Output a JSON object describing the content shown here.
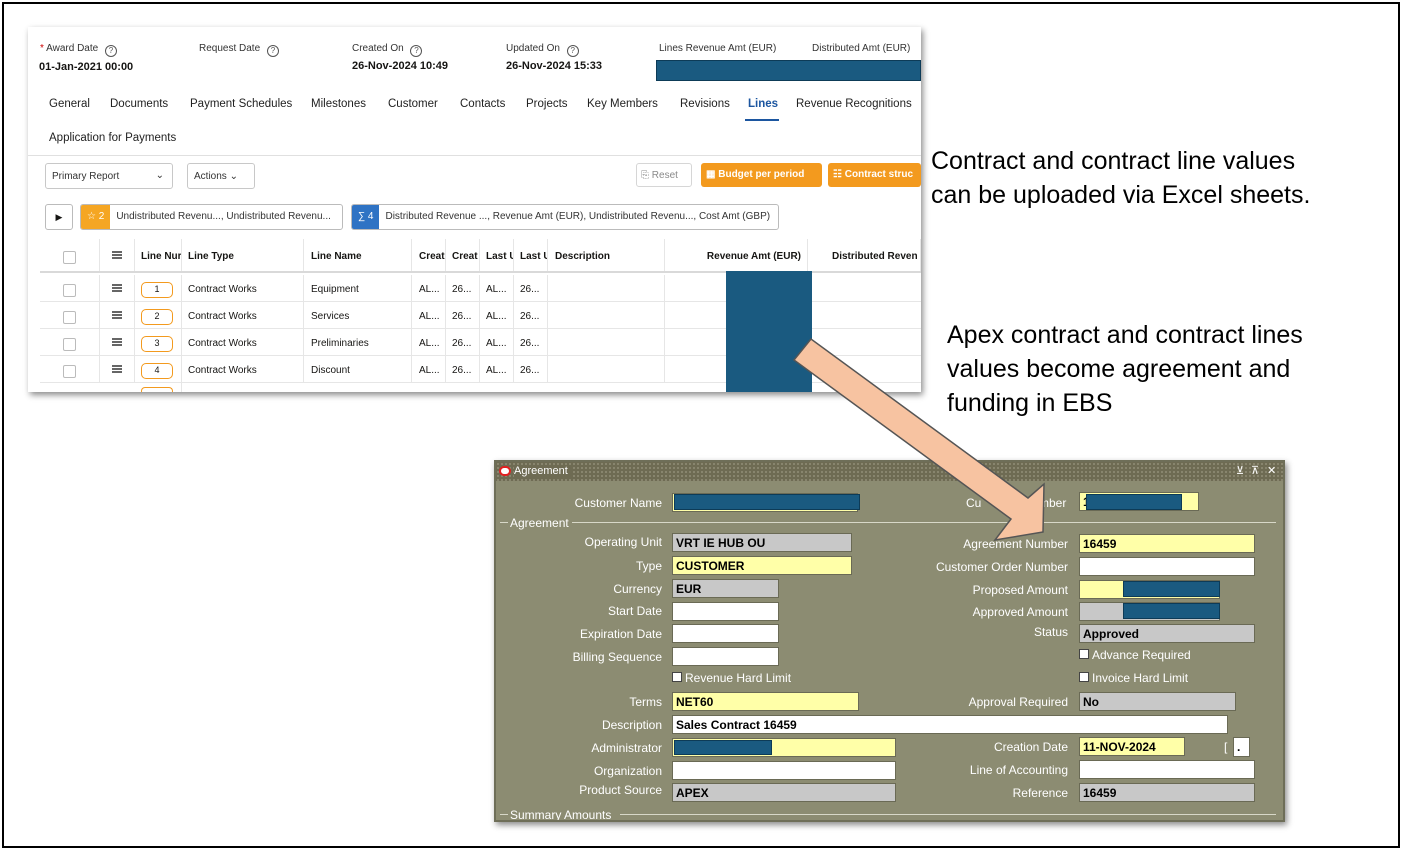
{
  "apex": {
    "header": {
      "award_date_label": "Award Date",
      "award_date_value": "01-Jan-2021 00:00",
      "request_date_label": "Request Date",
      "created_on_label": "Created On",
      "created_on_value": "26-Nov-2024 10:49",
      "updated_on_label": "Updated On",
      "updated_on_value": "26-Nov-2024 15:33",
      "lines_revenue_label": "Lines Revenue Amt (EUR)",
      "distributed_amt_label": "Distributed Amt (EUR)"
    },
    "tabs": [
      "General",
      "Documents",
      "Payment Schedules",
      "Milestones",
      "Customer",
      "Contacts",
      "Projects",
      "Key Members",
      "Revisions",
      "Lines",
      "Revenue Recognitions",
      "Application for Payments"
    ],
    "active_tab": "Lines",
    "toolbar": {
      "report": "Primary Report",
      "actions": "Actions",
      "reset": "Reset",
      "budget": "Budget per period",
      "contract": "Contract struc"
    },
    "filters": {
      "star_count": "2",
      "star_text": "Undistributed Revenu..., Undistributed Revenu...",
      "sum_count": "4",
      "sum_text": "Distributed Revenue ..., Revenue Amt (EUR), Undistributed Revenu..., Cost Amt (GBP)"
    },
    "columns": [
      "Line Nur",
      "Line Type",
      "Line Name",
      "Creat",
      "Creat",
      "Last U",
      "Last U",
      "Description",
      "Revenue Amt (EUR)",
      "Distributed Reven"
    ],
    "rows": [
      {
        "num": "1",
        "type": "Contract Works",
        "name": "Equipment",
        "c1": "AL...",
        "c2": "26...",
        "c3": "AL...",
        "c4": "26..."
      },
      {
        "num": "2",
        "type": "Contract Works",
        "name": "Services",
        "c1": "AL...",
        "c2": "26...",
        "c3": "AL...",
        "c4": "26..."
      },
      {
        "num": "3",
        "type": "Contract Works",
        "name": "Preliminaries",
        "c1": "AL...",
        "c2": "26...",
        "c3": "AL...",
        "c4": "26..."
      },
      {
        "num": "4",
        "type": "Contract Works",
        "name": "Discount",
        "c1": "AL...",
        "c2": "26...",
        "c3": "AL...",
        "c4": "26..."
      }
    ]
  },
  "notes": {
    "note1_line1": "Contract and contract line values",
    "note1_line2": "can be uploaded via Excel sheets.",
    "note2_line1": "Apex contract and contract lines",
    "note2_line2": "values become agreement and",
    "note2_line3": "funding in EBS"
  },
  "ebs": {
    "title": "Agreement",
    "customer_name_label": "Customer Name",
    "customer_number_label_left": "Cu",
    "customer_number_label_right": "mber",
    "customer_number_prefix": "1",
    "section_agreement": "Agreement",
    "operating_unit_label": "Operating Unit",
    "operating_unit": "VRT IE HUB OU",
    "type_label": "Type",
    "type": "CUSTOMER",
    "currency_label": "Currency",
    "currency": "EUR",
    "start_date_label": "Start Date",
    "expiration_date_label": "Expiration Date",
    "billing_sequence_label": "Billing Sequence",
    "revenue_hard_limit_label": "Revenue Hard Limit",
    "terms_label": "Terms",
    "terms": "NET60",
    "description_label": "Description",
    "description": "Sales Contract 16459",
    "administrator_label": "Administrator",
    "organization_label": "Organization",
    "product_source_label": "Product Source",
    "product_source": "APEX",
    "agreement_number_label": "Agreement Number",
    "agreement_number": "16459",
    "customer_order_number_label": "Customer Order Number",
    "proposed_amount_label": "Proposed Amount",
    "approved_amount_label": "Approved Amount",
    "status_label": "Status",
    "status": "Approved",
    "advance_required_label": "Advance Required",
    "invoice_hard_limit_label": "Invoice Hard Limit",
    "approval_required_label": "Approval Required",
    "approval_required": "No",
    "creation_date_label": "Creation Date",
    "creation_date": "11-NOV-2024",
    "line_of_accounting_label": "Line of Accounting",
    "reference_label": "Reference",
    "reference": "16459",
    "summary_amounts": "Summary Amounts",
    "bracket": "[",
    "dot": "."
  },
  "colors": {
    "redaction": "#1a5a80",
    "apex_orange": "#f39a1e",
    "apex_blue": "#1c56a0",
    "ebs_bg": "#8c8c72",
    "arrow_fill": "#f7c3a1"
  }
}
